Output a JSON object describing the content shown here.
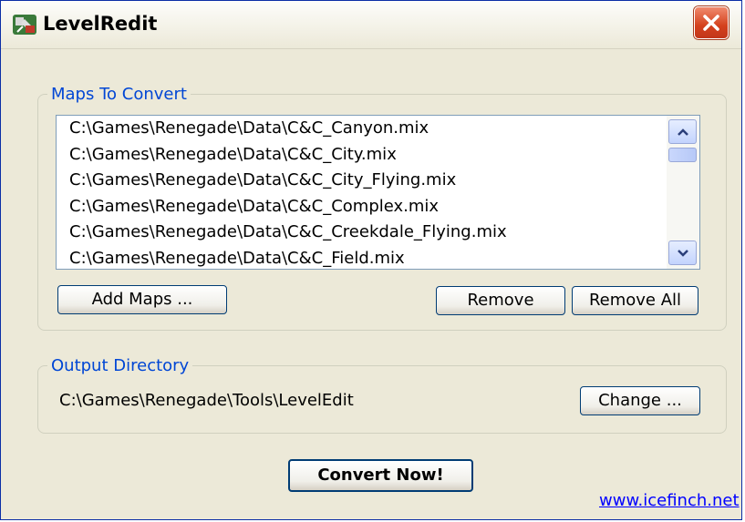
{
  "window": {
    "title": "LevelRedit"
  },
  "maps_group": {
    "legend": "Maps To Convert",
    "items": [
      "C:\\Games\\Renegade\\Data\\C&C_Canyon.mix",
      "C:\\Games\\Renegade\\Data\\C&C_City.mix",
      "C:\\Games\\Renegade\\Data\\C&C_City_Flying.mix",
      "C:\\Games\\Renegade\\Data\\C&C_Complex.mix",
      "C:\\Games\\Renegade\\Data\\C&C_Creekdale_Flying.mix",
      "C:\\Games\\Renegade\\Data\\C&C_Field.mix"
    ],
    "add_label": "Add Maps ...",
    "remove_label": "Remove",
    "remove_all_label": "Remove All"
  },
  "output_group": {
    "legend": "Output Directory",
    "path": "C:\\Games\\Renegade\\Tools\\LevelEdit",
    "change_label": "Change ..."
  },
  "convert_label": "Convert Now!",
  "link_text": "www.icefinch.net",
  "icons": {
    "app": "app-icon",
    "close": "close-icon",
    "scroll_up": "chevron-up-icon",
    "scroll_down": "chevron-down-icon"
  },
  "colors": {
    "window_bg": "#ece9d8",
    "legend": "#0046d5",
    "close_button": "#d4411d",
    "link": "#0000ff"
  }
}
